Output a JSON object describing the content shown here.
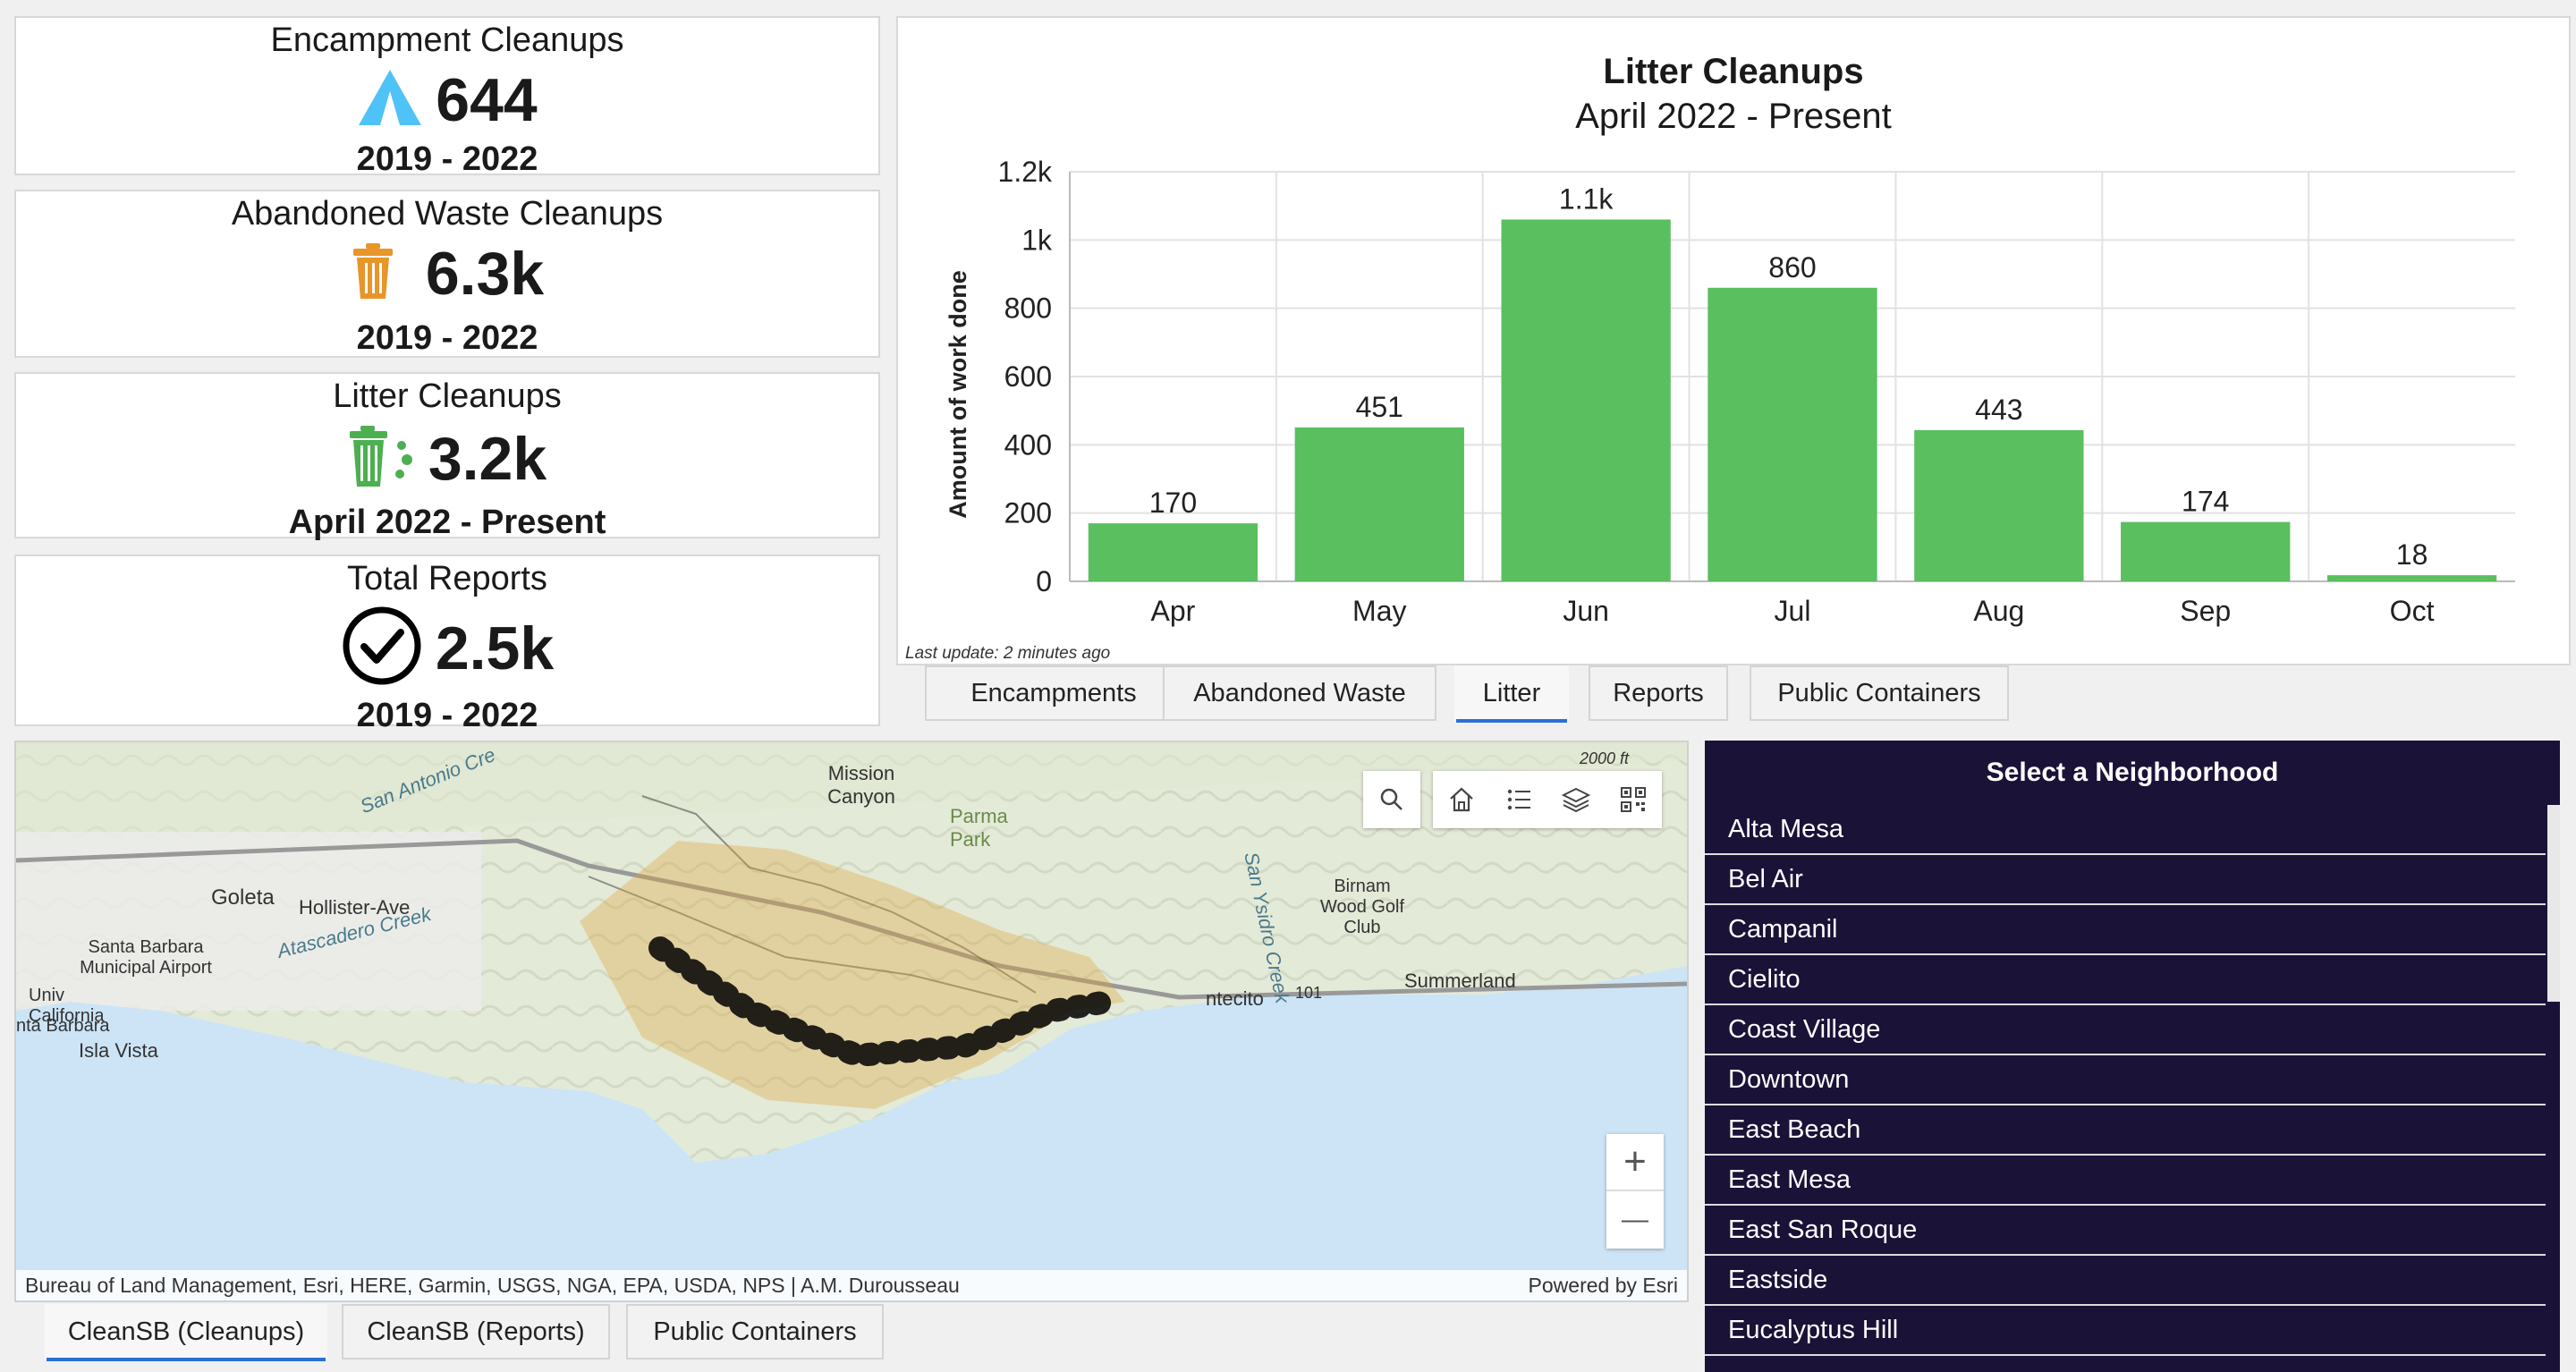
{
  "cards": [
    {
      "title": "Encampment Cleanups",
      "value": "644",
      "period": "2019 - 2022",
      "icon": "tent-icon",
      "icon_color": "#4fc3f7"
    },
    {
      "title": "Abandoned Waste Cleanups",
      "value": "6.3k",
      "period": "2019 - 2022",
      "icon": "trash-can-icon",
      "icon_color": "#e8952a"
    },
    {
      "title": "Litter Cleanups",
      "value": "3.2k",
      "period": "April 2022 - Present",
      "icon": "litter-bin-icon",
      "icon_color": "#4caf50"
    },
    {
      "title": "Total Reports",
      "value": "2.5k",
      "period": "2019 - 2022",
      "icon": "check-circle-icon",
      "icon_color": "#000000"
    }
  ],
  "chart_data": {
    "type": "bar",
    "title": "Litter Cleanups",
    "subtitle": "April 2022 - Present",
    "ylabel": "Amount of work done",
    "xlabel": "",
    "categories": [
      "Apr",
      "May",
      "Jun",
      "Jul",
      "Aug",
      "Sep",
      "Oct"
    ],
    "values": [
      170,
      451,
      1060,
      860,
      443,
      174,
      18
    ],
    "data_labels": [
      "170",
      "451",
      "1.1k",
      "860",
      "443",
      "174",
      "18"
    ],
    "ylim": [
      0,
      1200
    ],
    "yticks": [
      0,
      200,
      400,
      600,
      800,
      1000,
      1200
    ],
    "ytick_labels": [
      "0",
      "200",
      "400",
      "600",
      "800",
      "1k",
      "1.2k"
    ],
    "grid": true,
    "bar_color": "#5abf5f"
  },
  "last_update": "Last update: 2 minutes ago",
  "chart_tabs": [
    {
      "label": "Encampments",
      "active": false
    },
    {
      "label": "Abandoned Waste",
      "active": false
    },
    {
      "label": "Litter",
      "active": true
    },
    {
      "label": "Reports",
      "active": false
    },
    {
      "label": "Public Containers",
      "active": false
    }
  ],
  "map": {
    "labels": {
      "goleta": "Goleta",
      "hollister": "Hollister-Ave",
      "santa_barbara_airport": "Santa Barbara Municipal Airport",
      "univ_california": "Univ California",
      "santa_barbara": "nta Barbara",
      "isla_vista": "Isla Vista",
      "atascadero": "Atascadero Creek",
      "san_antonio": "San Antonio Cre",
      "mission_canyon": "Mission Canyon",
      "parma_park": "Parma Park",
      "san_ysidro": "San Ysidro Creek",
      "birnam": "Birnam Wood Golf Club",
      "summerland": "Summerland",
      "montecito": "ntecito",
      "route": "101",
      "elevation": "2000 ft"
    },
    "attribution": "Bureau of Land Management, Esri, HERE, Garmin, USGS, NGA, EPA, USDA, NPS | A.M. Durousseau",
    "powered_by": "Powered by Esri",
    "zoom_in": "+",
    "zoom_out": "—"
  },
  "neighborhoods": {
    "title": "Select a Neighborhood",
    "items": [
      "Alta Mesa",
      "Bel Air",
      "Campanil",
      "Cielito",
      "Coast Village",
      "Downtown",
      "East Beach",
      "East Mesa",
      "East San Roque",
      "Eastside",
      "Eucalyptus Hill"
    ]
  },
  "bottom_tabs": [
    {
      "label": "CleanSB (Cleanups)",
      "active": true
    },
    {
      "label": "CleanSB (Reports)",
      "active": false
    },
    {
      "label": "Public Containers",
      "active": false
    }
  ]
}
